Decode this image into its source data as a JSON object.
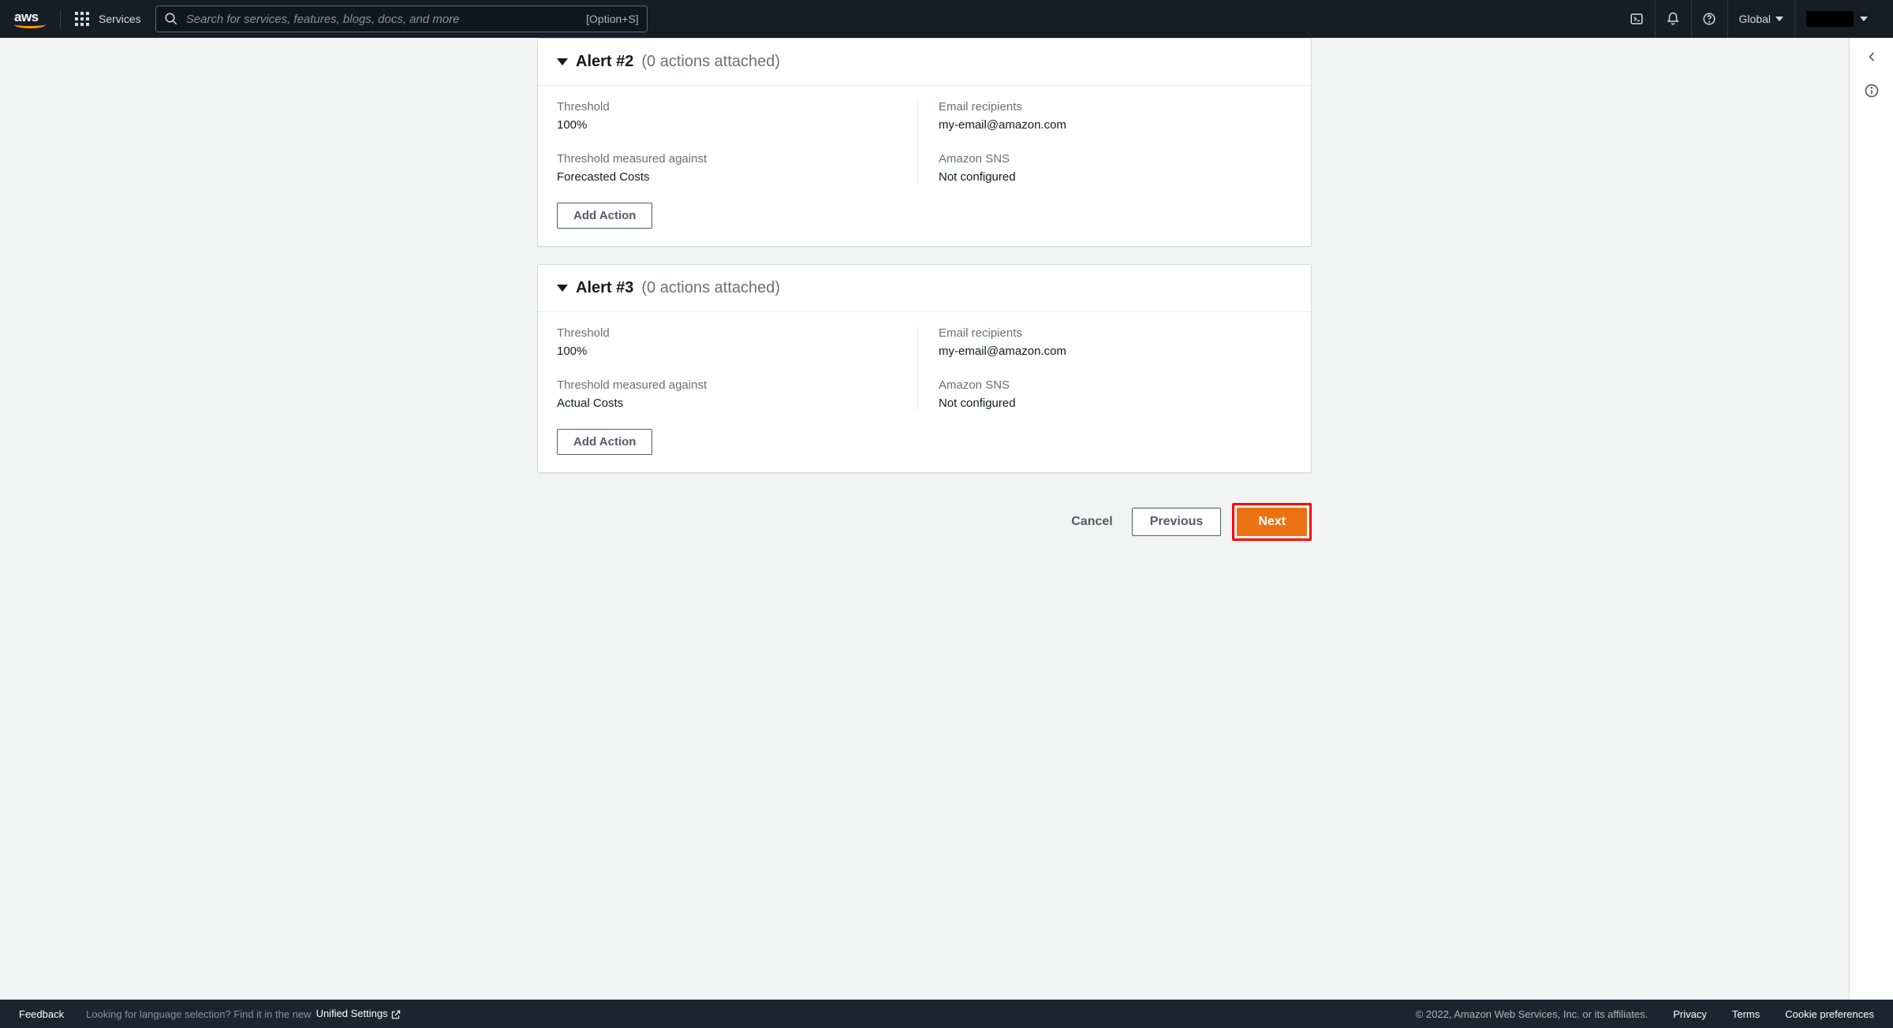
{
  "topnav": {
    "services_label": "Services",
    "search_placeholder": "Search for services, features, blogs, docs, and more",
    "search_shortcut": "[Option+S]",
    "region": "Global"
  },
  "alerts": [
    {
      "title": "Alert #2",
      "subtitle": "(0 actions attached)",
      "threshold_label": "Threshold",
      "threshold_value": "100%",
      "measured_label": "Threshold measured against",
      "measured_value": "Forecasted Costs",
      "email_label": "Email recipients",
      "email_value": "my-email@amazon.com",
      "sns_label": "Amazon SNS",
      "sns_value": "Not configured",
      "add_action_label": "Add Action"
    },
    {
      "title": "Alert #3",
      "subtitle": "(0 actions attached)",
      "threshold_label": "Threshold",
      "threshold_value": "100%",
      "measured_label": "Threshold measured against",
      "measured_value": "Actual Costs",
      "email_label": "Email recipients",
      "email_value": "my-email@amazon.com",
      "sns_label": "Amazon SNS",
      "sns_value": "Not configured",
      "add_action_label": "Add Action"
    }
  ],
  "wizard": {
    "cancel": "Cancel",
    "previous": "Previous",
    "next": "Next"
  },
  "bottombar": {
    "feedback": "Feedback",
    "lang_prompt": "Looking for language selection? Find it in the new ",
    "unified_settings": "Unified Settings",
    "copyright": "© 2022, Amazon Web Services, Inc. or its affiliates.",
    "privacy": "Privacy",
    "terms": "Terms",
    "cookie": "Cookie preferences"
  }
}
